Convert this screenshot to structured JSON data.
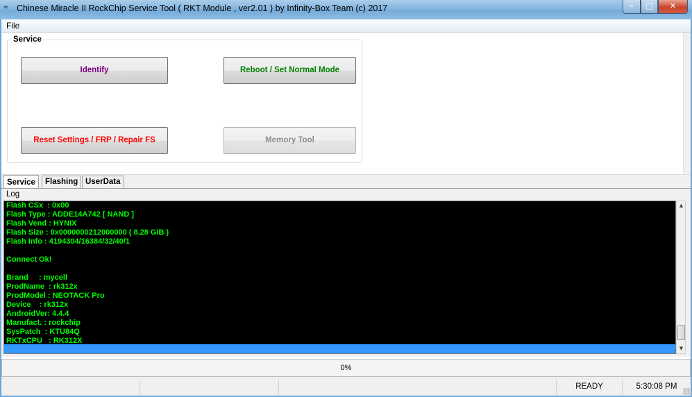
{
  "window": {
    "title": "Chinese Miracle II RockChip Service Tool ( RKT Module , ver2.01  ) by Infinity-Box Team (c) 2017",
    "icon": "app-icon",
    "controls": {
      "minimize": "–",
      "maximize": "□",
      "close": "✕"
    }
  },
  "menu": {
    "file": "File"
  },
  "service_panel": {
    "legend": "Service",
    "buttons": {
      "identify": "Identify",
      "reboot": "Reboot / Set Normal Mode",
      "reset": "Reset Settings / FRP / Repair FS",
      "memory": "Memory Tool"
    },
    "colors": {
      "identify": "#800080",
      "reboot": "#008000",
      "reset": "#ff0000",
      "memory_disabled": "#8d8d8d"
    }
  },
  "tabs": {
    "service": "Service",
    "flashing": "Flashing",
    "userdata": "UserData",
    "active": "Service"
  },
  "log": {
    "label": "Log",
    "text_color": "#00ff00",
    "lines": [
      "Flash CSx  : 0x00",
      "Flash Type : ADDE14A742 [ NAND ]",
      "Flash Vend : HYNIX",
      "Flash Size : 0x0000000212000000 ( 8.28 GiB )",
      "Flash Info : 4194304/16384/32/40/1",
      "",
      "Connect Ok!",
      "",
      "Brand     : mycell",
      "ProdName  : rk312x",
      "ProdModel : NEOTACK Pro",
      "Device    : rk312x",
      "AndroidVer: 4.4.4",
      "Manufact. : rockchip",
      "SysPatch  : KTU84Q",
      "RKTxCPU   : RK312X"
    ]
  },
  "progress": {
    "text": "0%",
    "value": 0
  },
  "status": {
    "state": "READY",
    "time": "5:30:08 PM"
  }
}
